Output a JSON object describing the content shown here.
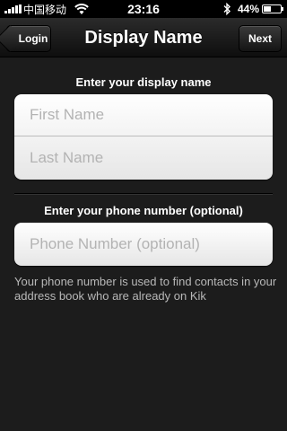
{
  "status_bar": {
    "carrier": "中国移动",
    "time": "23:16",
    "battery_percent": "44%",
    "battery_level": 0.44,
    "icons": [
      "signal-icon",
      "wifi-icon",
      "bluetooth-icon",
      "battery-icon"
    ]
  },
  "navbar": {
    "title": "Display Name",
    "back_label": "Login",
    "next_label": "Next"
  },
  "name_section": {
    "heading": "Enter your display name",
    "first_name_placeholder": "First Name",
    "first_name_value": "",
    "last_name_placeholder": "Last Name",
    "last_name_value": ""
  },
  "phone_section": {
    "heading": "Enter your phone number (optional)",
    "phone_placeholder": "Phone Number (optional)",
    "phone_value": "",
    "help_text": "Your phone number is used to find contacts in your address book who are already on Kik"
  },
  "colors": {
    "background": "#1c1c1c",
    "navbar": "#1a1a1a",
    "field_bg": "#ffffff",
    "placeholder": "#b3b3b3",
    "help_text": "#b8b8b8"
  }
}
